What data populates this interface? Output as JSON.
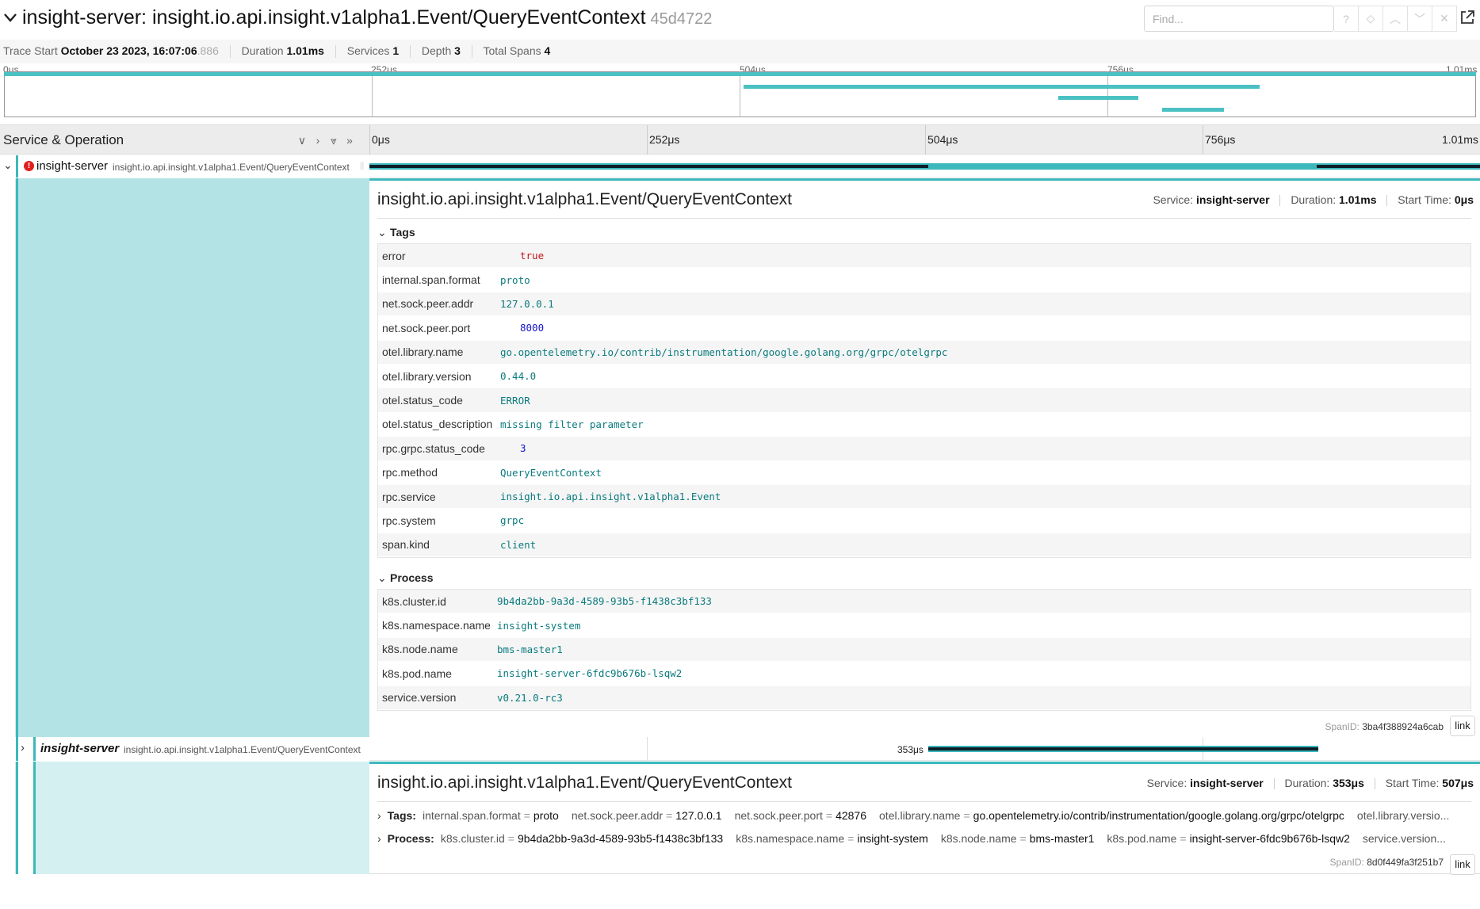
{
  "header": {
    "title": "insight-server: insight.io.api.insight.v1alpha1.Event/QueryEventContext",
    "trace_id": "45d4722",
    "find_placeholder": "Find..."
  },
  "meta": {
    "trace_start_label": "Trace Start",
    "trace_start_value": "October 23 2023, 16:07:06",
    "trace_start_ms": ".886",
    "duration_label": "Duration",
    "duration_value": "1.01ms",
    "services_label": "Services",
    "services_value": "1",
    "depth_label": "Depth",
    "depth_value": "3",
    "total_spans_label": "Total Spans",
    "total_spans_value": "4"
  },
  "minimap_ticks": [
    "0μs",
    "252μs",
    "504μs",
    "756μs",
    "1.01ms"
  ],
  "column_header": {
    "title": "Service & Operation",
    "ticks": [
      "0μs",
      "252μs",
      "504μs",
      "756μs",
      "1.01ms"
    ]
  },
  "span1": {
    "service": "insight-server",
    "operation": "insight.io.api.insight.v1alpha1.Event/QueryEventContext",
    "detail_title": "insight.io.api.insight.v1alpha1.Event/QueryEventContext",
    "service_label": "Service:",
    "service_value": "insight-server",
    "duration_label": "Duration:",
    "duration_value": "1.01ms",
    "start_label": "Start Time:",
    "start_value": "0μs",
    "tags_label": "Tags",
    "tags": [
      {
        "k": "error",
        "v": "true",
        "kind": "red"
      },
      {
        "k": "internal.span.format",
        "v": "proto",
        "kind": "str"
      },
      {
        "k": "net.sock.peer.addr",
        "v": "127.0.0.1",
        "kind": "str"
      },
      {
        "k": "net.sock.peer.port",
        "v": "8000",
        "kind": "num"
      },
      {
        "k": "otel.library.name",
        "v": "go.opentelemetry.io/contrib/instrumentation/google.golang.org/grpc/otelgrpc",
        "kind": "str"
      },
      {
        "k": "otel.library.version",
        "v": "0.44.0",
        "kind": "str"
      },
      {
        "k": "otel.status_code",
        "v": "ERROR",
        "kind": "str"
      },
      {
        "k": "otel.status_description",
        "v": "missing filter parameter",
        "kind": "str"
      },
      {
        "k": "rpc.grpc.status_code",
        "v": "3",
        "kind": "num"
      },
      {
        "k": "rpc.method",
        "v": "QueryEventContext",
        "kind": "str"
      },
      {
        "k": "rpc.service",
        "v": "insight.io.api.insight.v1alpha1.Event",
        "kind": "str"
      },
      {
        "k": "rpc.system",
        "v": "grpc",
        "kind": "str"
      },
      {
        "k": "span.kind",
        "v": "client",
        "kind": "str"
      }
    ],
    "process_label": "Process",
    "process": [
      {
        "k": "k8s.cluster.id",
        "v": "9b4da2bb-9a3d-4589-93b5-f1438c3bf133"
      },
      {
        "k": "k8s.namespace.name",
        "v": "insight-system"
      },
      {
        "k": "k8s.node.name",
        "v": "bms-master1"
      },
      {
        "k": "k8s.pod.name",
        "v": "insight-server-6fdc9b676b-lsqw2"
      },
      {
        "k": "service.version",
        "v": "v0.21.0-rc3"
      }
    ],
    "spanid_label": "SpanID:",
    "spanid_value": "3ba4f388924a6cab",
    "link_label": "link"
  },
  "span2": {
    "service": "insight-server",
    "operation": "insight.io.api.insight.v1alpha1.Event/QueryEventContext",
    "bar_label": "353μs",
    "detail_title": "insight.io.api.insight.v1alpha1.Event/QueryEventContext",
    "service_label": "Service:",
    "service_value": "insight-server",
    "duration_label": "Duration:",
    "duration_value": "353μs",
    "start_label": "Start Time:",
    "start_value": "507μs",
    "tags_label": "Tags:",
    "tags": [
      {
        "k": "internal.span.format",
        "v": "proto"
      },
      {
        "k": "net.sock.peer.addr",
        "v": "127.0.0.1"
      },
      {
        "k": "net.sock.peer.port",
        "v": "42876"
      },
      {
        "k": "otel.library.name",
        "v": "go.opentelemetry.io/contrib/instrumentation/google.golang.org/grpc/otelgrpc"
      },
      {
        "k": "otel.library.versio...",
        "v": ""
      }
    ],
    "process_label": "Process:",
    "process": [
      {
        "k": "k8s.cluster.id",
        "v": "9b4da2bb-9a3d-4589-93b5-f1438c3bf133"
      },
      {
        "k": "k8s.namespace.name",
        "v": "insight-system"
      },
      {
        "k": "k8s.node.name",
        "v": "bms-master1"
      },
      {
        "k": "k8s.pod.name",
        "v": "insight-server-6fdc9b676b-lsqw2"
      },
      {
        "k": "service.version...",
        "v": ""
      }
    ],
    "spanid_label": "SpanID:",
    "spanid_value": "8d0f449fa3f251b7",
    "link_label": "link"
  },
  "colors": {
    "accent": "#3cb8bc",
    "error": "#e02020",
    "detail_bg": "#b4e3e6"
  }
}
